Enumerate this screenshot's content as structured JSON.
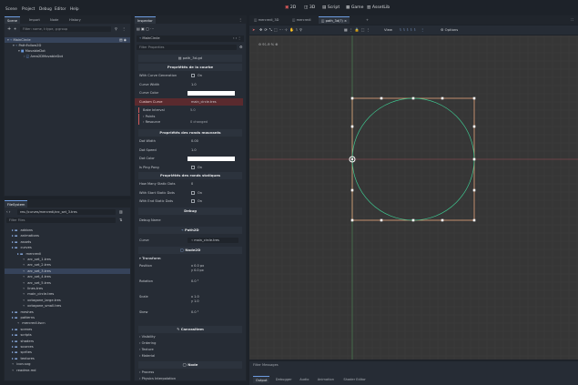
{
  "menu": [
    "Scene",
    "Project",
    "Debug",
    "Editor",
    "Help"
  ],
  "modes": [
    {
      "icon": "2D",
      "label": "2D",
      "active": true
    },
    {
      "icon": "3D",
      "label": "3D"
    },
    {
      "icon": "Script",
      "label": "Script"
    },
    {
      "icon": "Game",
      "label": "Game"
    },
    {
      "icon": "AssetLib",
      "label": "AssetLib"
    }
  ],
  "scene_dock": {
    "tabs": [
      "Scene",
      "Import",
      "Node",
      "History"
    ],
    "filter_placeholder": "Filter: name, t:type, g:group",
    "nodes": [
      "MainCircle",
      "PathFollow2D",
      "MovableDot",
      "Area2DMovableDot"
    ]
  },
  "filesystem": {
    "title": "FileSystem",
    "path": "res://curves/mercredi/arc_set_3.tres",
    "filter_placeholder": "Filter Files",
    "items": [
      "addons",
      "animations",
      "assets",
      "curves",
      "mercredi",
      "arc_set_1.tres",
      "arc_set_2.tres",
      "arc_set_3.tres",
      "arc_set_4.tres",
      "arc_set_5.tres",
      "lines.tres",
      "main_circle.tres",
      "octagone_large.tres",
      "octagone_small.tres",
      "meshes",
      "patterns",
      "mercredi.tscn",
      "scenes",
      "scripts",
      "shaders",
      "sources",
      "sprites",
      "textures",
      "icon.svg",
      "readme.md"
    ]
  },
  "inspector": {
    "tab": "Inspector",
    "node_name": "MainCircle",
    "filter_placeholder": "Filter Properties",
    "script_label": "path_3d.gd",
    "sec_curve": "Propriétés de la courbe",
    "props_curve": [
      {
        "name": "With Curve Generation",
        "value": "On"
      },
      {
        "name": "Curve Width",
        "value": "1.0"
      },
      {
        "name": "Curve Color",
        "value": ""
      },
      {
        "name": "Custom Curve",
        "value": "main_circle.tres"
      }
    ],
    "sub_custom": [
      {
        "name": "Bake Interval",
        "value": "5.0"
      },
      {
        "name": "Points",
        "value": ""
      },
      {
        "name": "Resource",
        "value": "0 changed"
      }
    ],
    "sec_moving": "Propriétés des ronds mouvants",
    "props_moving": [
      {
        "name": "Dot Width",
        "value": "0.00"
      },
      {
        "name": "Dot Speed",
        "value": "1.0"
      },
      {
        "name": "Dot Color",
        "value": ""
      },
      {
        "name": "Is Ping Pong",
        "value": "On"
      }
    ],
    "sec_static": "Propriétés des ronds statiques",
    "props_static": [
      {
        "name": "How Many Static Dots",
        "value": "0"
      },
      {
        "name": "With Start Static Dots",
        "value": "On"
      },
      {
        "name": "With End Static Dots",
        "value": "On"
      }
    ],
    "sec_debug": "Debug",
    "debug_name": "Debug Name",
    "path2d": "Path2D",
    "curve_prop": "Curve",
    "curve_val": "main_circle.tres",
    "node2d": "Node2D",
    "transform": "Transform",
    "transform_props": [
      {
        "name": "Position",
        "value": "x 0.0 px",
        "value2": "y 0.0 px"
      },
      {
        "name": "Rotation",
        "value": "0.0 °"
      },
      {
        "name": "Scale",
        "value": "x 1.0",
        "value2": "y 1.0"
      },
      {
        "name": "Skew",
        "value": "0.0 °"
      }
    ],
    "canvas": "CanvasItem",
    "canvas_sub": [
      "Visibility",
      "Ordering",
      "Texture",
      "Material"
    ],
    "node": "Node",
    "node_sub": [
      "Process",
      "Physics Interpolation",
      "Auto Translate",
      "Editor Description"
    ]
  },
  "editor_tabs": [
    "mercredi_3D",
    "mercredi",
    "path_3d(?)"
  ],
  "viewport": {
    "zoom": "91.9 %",
    "view_label": "View",
    "options_label": "Options"
  },
  "bottom": {
    "filter": "Filter Messages",
    "tabs": [
      "Output",
      "Debugger",
      "Audio",
      "Animation",
      "Shader Editor"
    ]
  }
}
